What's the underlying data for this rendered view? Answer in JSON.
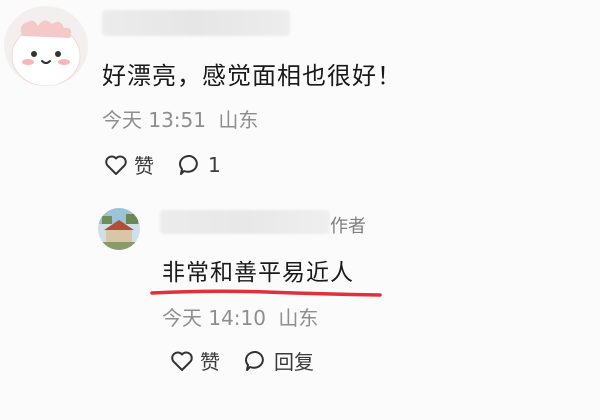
{
  "comment": {
    "text": "好漂亮，感觉面相也很好！",
    "time": "今天 13:51",
    "location": "山东",
    "like_label": "赞",
    "reply_count": "1"
  },
  "reply": {
    "author_badge": "作者",
    "text": "非常和善平易近人",
    "time": "今天 14:10",
    "location": "山东",
    "like_label": "赞",
    "reply_label": "回复"
  },
  "colors": {
    "underline": "#e0303a",
    "meta": "#8e8e8e"
  },
  "icons": [
    "heart-icon",
    "comment-icon"
  ]
}
